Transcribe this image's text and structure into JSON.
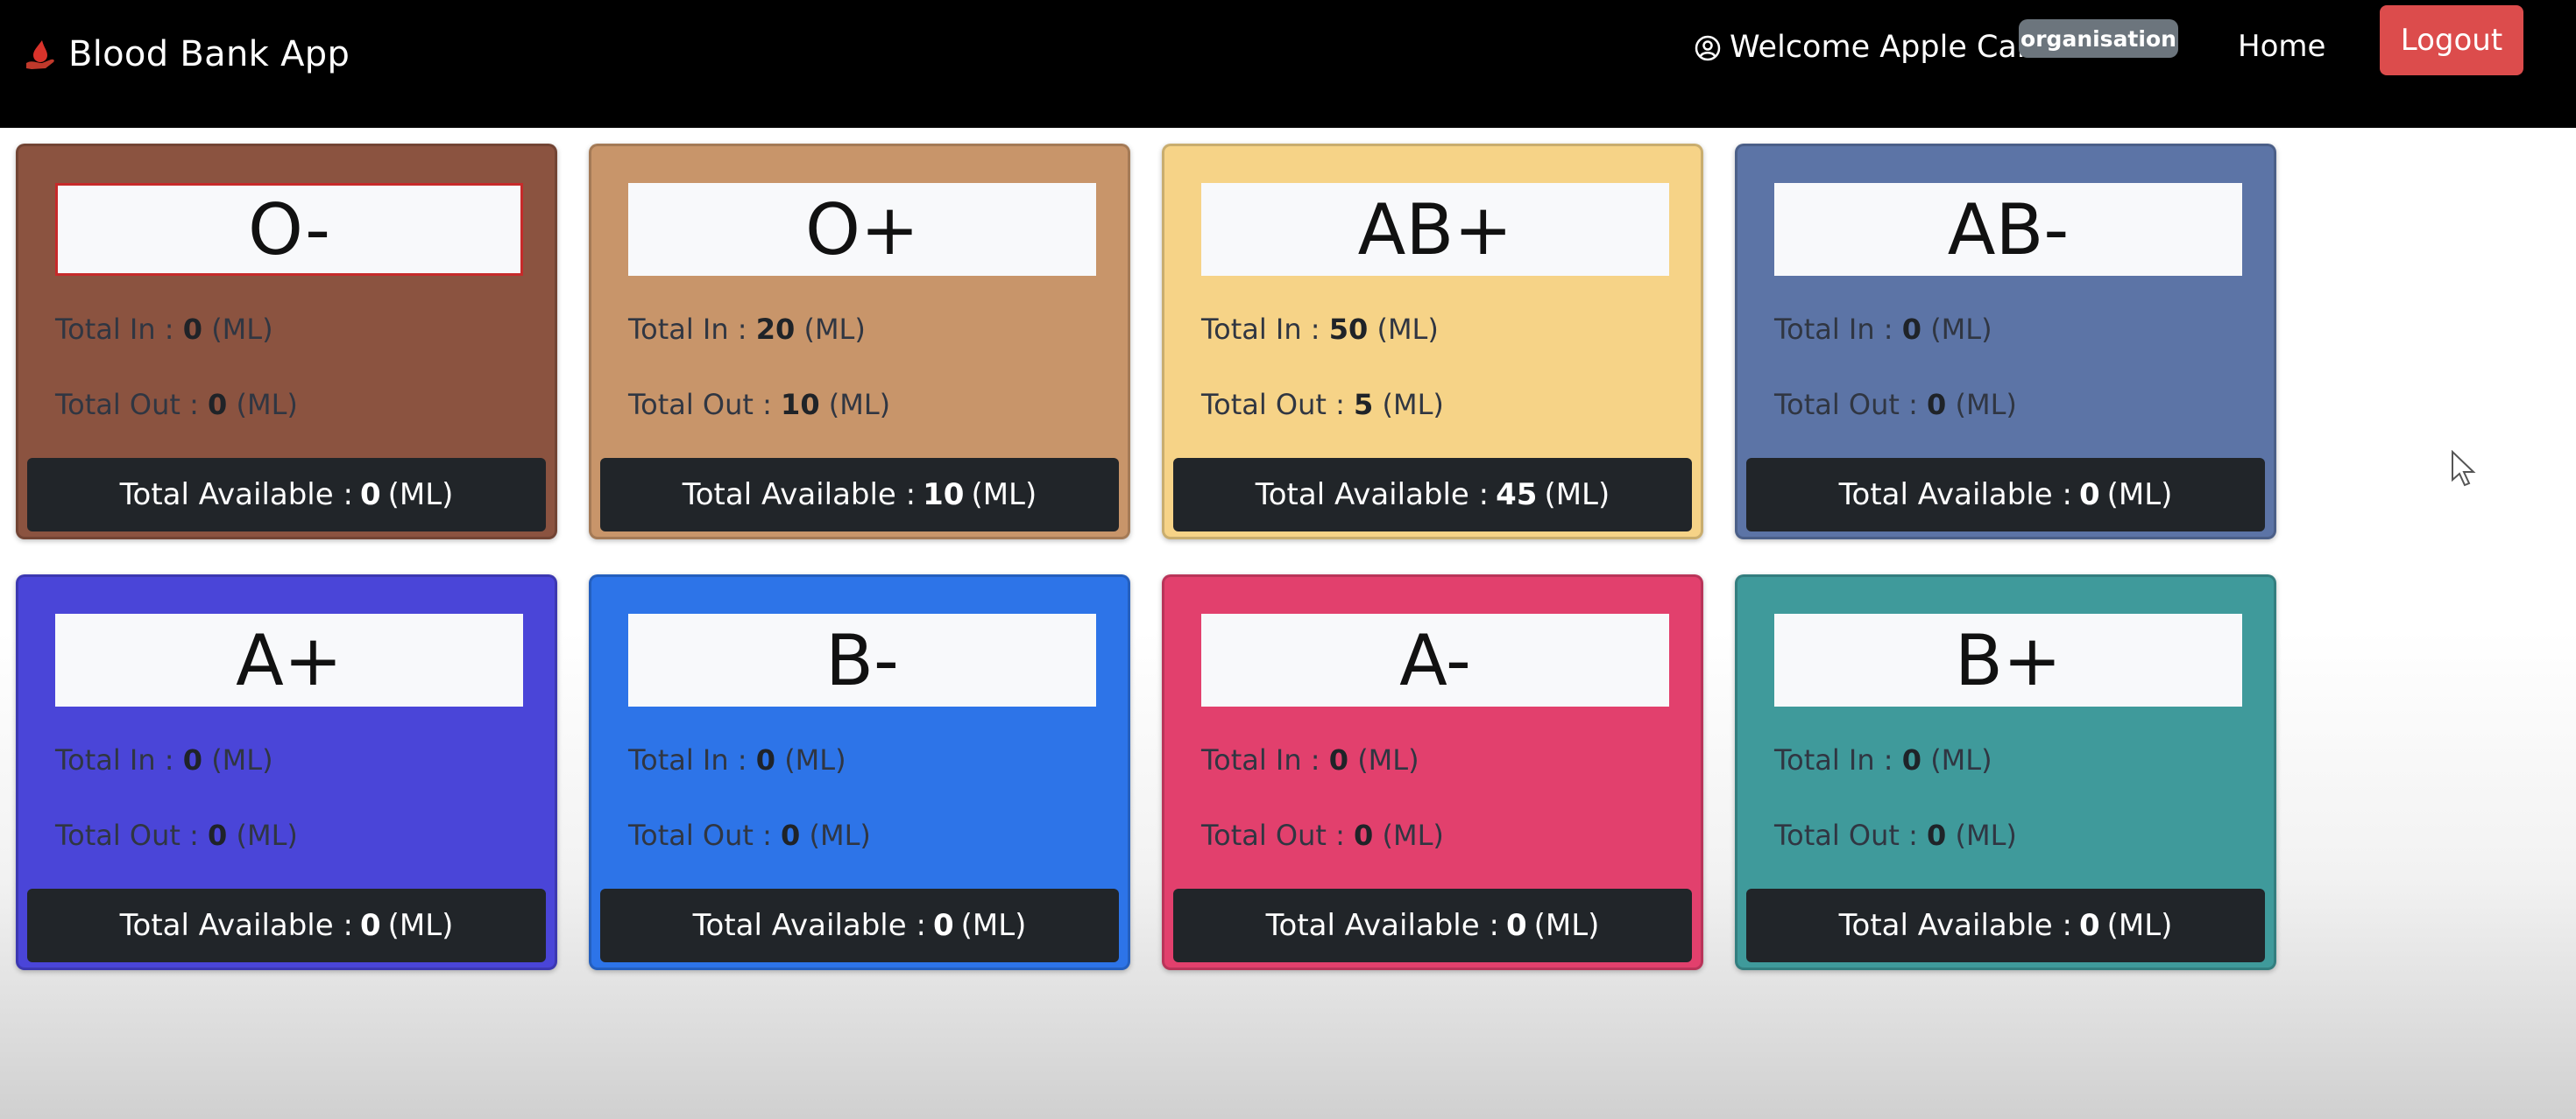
{
  "navbar": {
    "brand": "Blood Bank App",
    "brand_icon": "blood-drop-hand-icon",
    "welcome": "Welcome Apple Care",
    "user_icon": "user-circle-icon",
    "role_badge": "organisation",
    "home_link": "Home",
    "logout_label": "Logout",
    "logout_color": "#dc4c4c"
  },
  "labels": {
    "total_in": "Total In : ",
    "total_out": "Total Out : ",
    "total_available": "Total Available : ",
    "unit": "(ML)"
  },
  "inventory": [
    {
      "group": "O-",
      "total_in": "0",
      "total_out": "0",
      "available": "0",
      "color": "#8b5340"
    },
    {
      "group": "O+",
      "total_in": "20",
      "total_out": "10",
      "available": "10",
      "color": "#c8956a"
    },
    {
      "group": "AB+",
      "total_in": "50",
      "total_out": "5",
      "available": "45",
      "color": "#f6d387"
    },
    {
      "group": "AB-",
      "total_in": "0",
      "total_out": "0",
      "available": "0",
      "color": "#5c74a6"
    },
    {
      "group": "A+",
      "total_in": "0",
      "total_out": "0",
      "available": "0",
      "color": "#4a45d8"
    },
    {
      "group": "B-",
      "total_in": "0",
      "total_out": "0",
      "available": "0",
      "color": "#2d74e8"
    },
    {
      "group": "A-",
      "total_in": "0",
      "total_out": "0",
      "available": "0",
      "color": "#e2406d"
    },
    {
      "group": "B+",
      "total_in": "0",
      "total_out": "0",
      "available": "0",
      "color": "#3f9a9b"
    }
  ]
}
